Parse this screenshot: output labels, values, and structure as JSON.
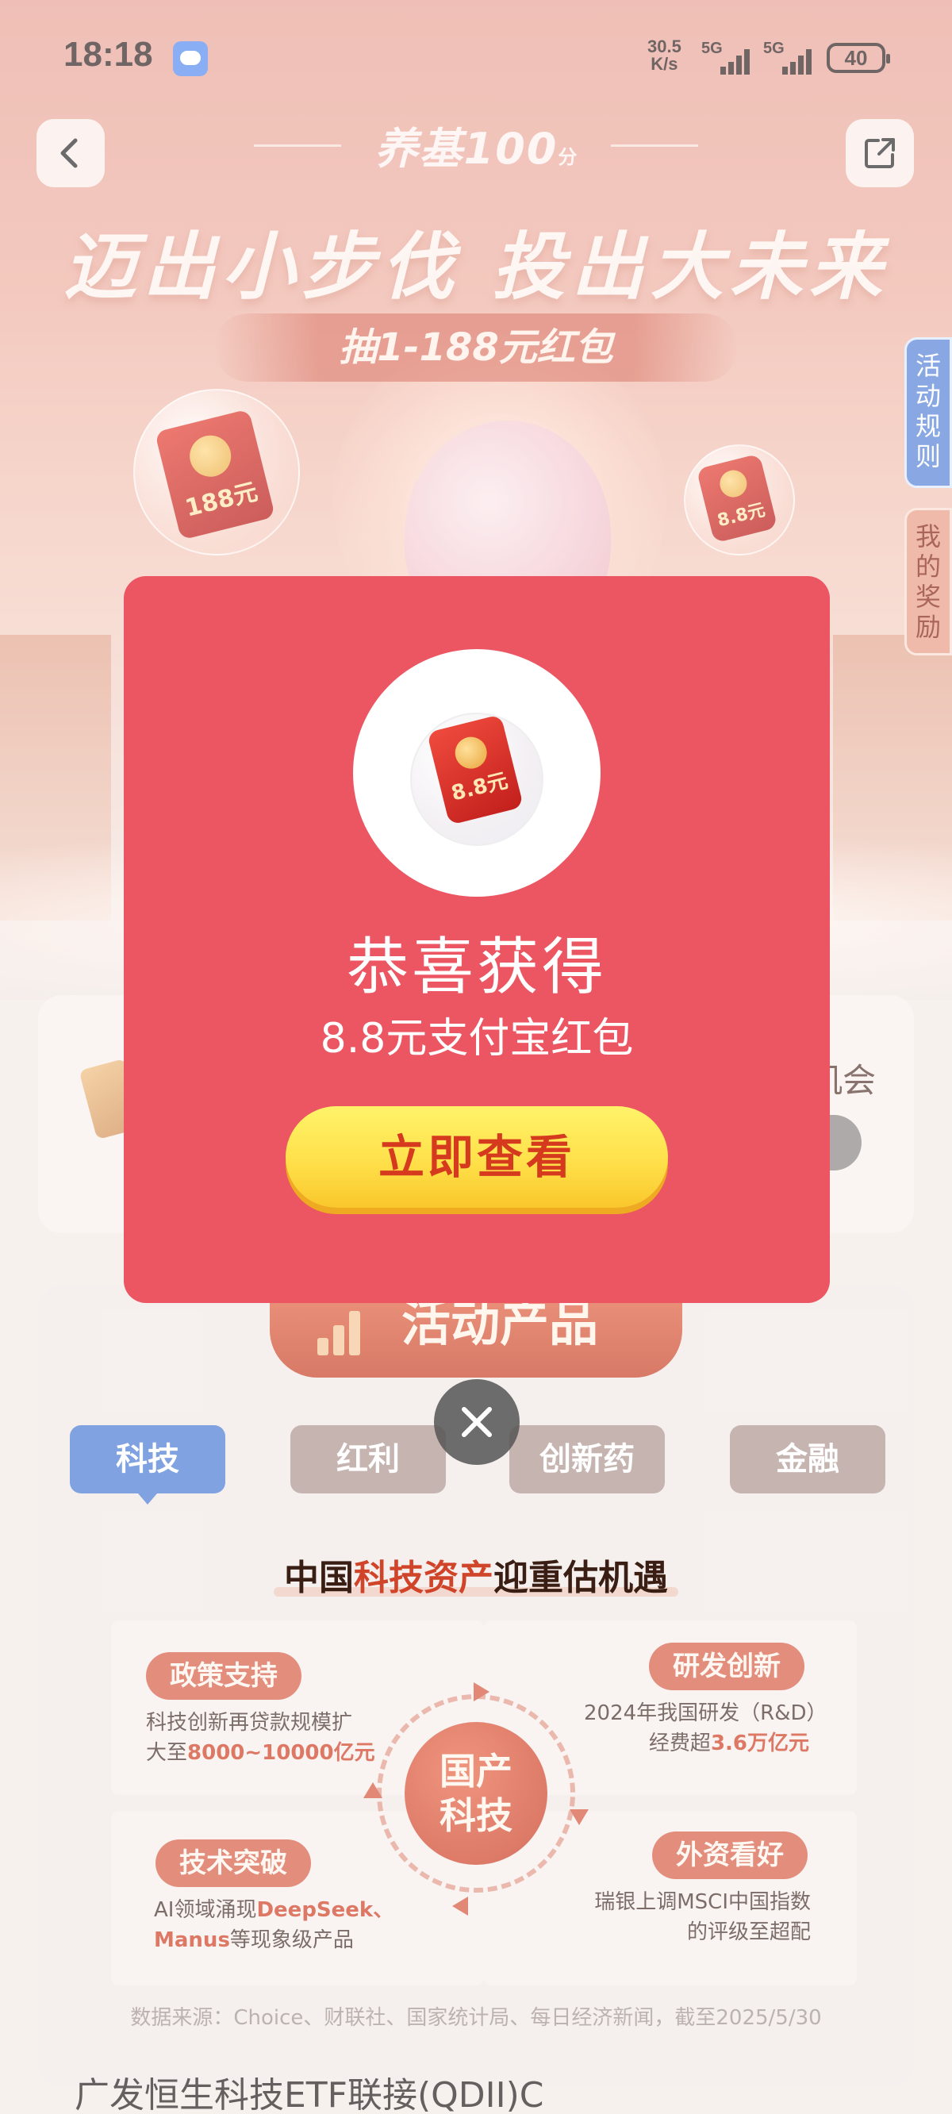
{
  "status_bar": {
    "time": "18:18",
    "net_speed_value": "30.5",
    "net_speed_unit": "K/s",
    "network_1": "5G",
    "network_2": "5G",
    "battery": "40",
    "icons": [
      "message-app-icon",
      "signal-icon",
      "signal-icon",
      "battery-icon"
    ]
  },
  "header": {
    "brand": "养基100",
    "brand_sub": "分",
    "slogan": "迈出小步伐 投出大未来",
    "lottery_banner": "抽1-188元红包",
    "bubble_left_amount": "188元",
    "bubble_right_amount": "8.8元",
    "icons": {
      "back": "back-arrow-icon",
      "share": "share-icon"
    }
  },
  "side_tabs": {
    "rules": "活动规则",
    "rewards": "我的奖励"
  },
  "chance_card": {
    "partial_text": "机会"
  },
  "products": {
    "badge": "活动产品",
    "tabs": [
      "科技",
      "红利",
      "创新药",
      "金融"
    ],
    "active_tab": "科技",
    "section_title_pre": "中国",
    "section_title_hl": "科技资产",
    "section_title_post": "迎重估机遇",
    "core_line1": "国产",
    "core_line2": "科技",
    "boxes": {
      "policy": {
        "title": "政策支持",
        "line1": "科技创新再贷款规模扩",
        "line2_pre": "大至",
        "line2_num": "8000~10000亿元"
      },
      "rnd": {
        "title": "研发创新",
        "line1": "2024年我国研发（R&D）",
        "line2_pre": "经费超",
        "line2_num": "3.6万亿元"
      },
      "tech": {
        "title": "技术突破",
        "line1_pre": "AI领域涌现",
        "line1_num": "DeepSeek、",
        "line2_num": "Manus",
        "line2_post": "等现象级产品"
      },
      "foreign": {
        "title": "外资看好",
        "line1": "瑞银上调MSCI中国指数",
        "line2": "的评级至超配"
      }
    },
    "source_note": "数据来源：Choice、财联社、国家统计局、每日经济新闻，截至2025/5/30",
    "fund_name": "广发恒生科技ETF联接(QDII)C"
  },
  "modal": {
    "packet_amount": "8.8元",
    "title": "恭喜获得",
    "subtitle": "8.8元支付宝红包",
    "button": "立即查看",
    "close_icon": "close-icon",
    "colors": {
      "background": "#ec5562",
      "button": "#ffe04a",
      "button_text": "#d53a1e"
    }
  }
}
